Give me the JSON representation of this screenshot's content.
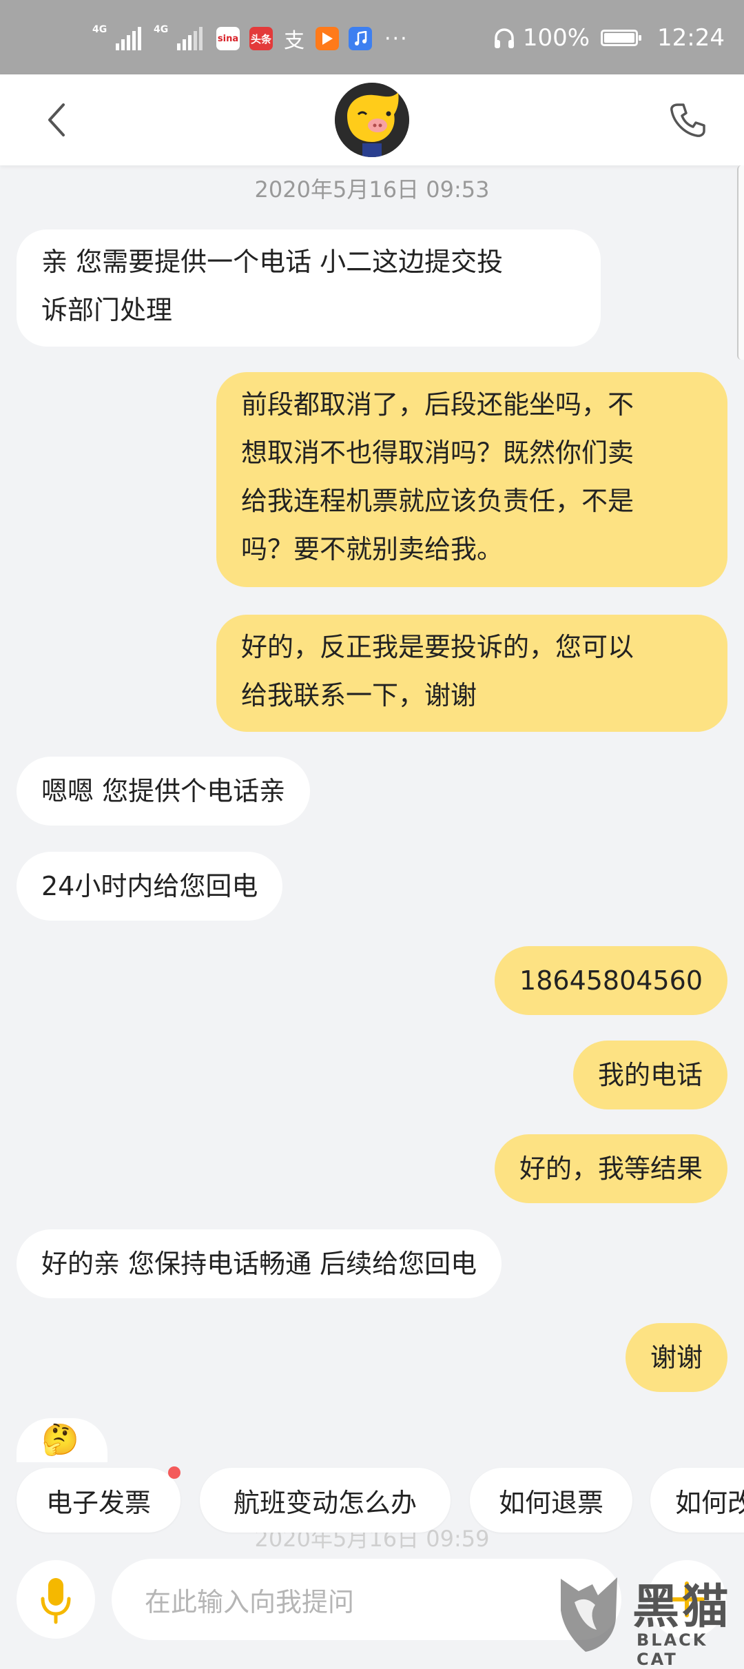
{
  "status_bar": {
    "network1": "4G",
    "network2": "4G",
    "apps": [
      "sina",
      "头条",
      "支",
      "play",
      "music"
    ],
    "more": "···",
    "battery_percent": "100%",
    "time": "12:24"
  },
  "header": {
    "back_icon": "chevron-left-icon",
    "avatar": "fliggy-mascot-avatar",
    "call_icon": "phone-icon"
  },
  "chat": {
    "timestamp": "2020年5月16日 09:53",
    "messages": [
      {
        "side": "in",
        "line1": "亲   您需要提供一个电话  小二这边提交投",
        "line2": "诉部门处理"
      },
      {
        "side": "out",
        "line1": "前段都取消了，后段还能坐吗，不",
        "line2": "想取消不也得取消吗？既然你们卖",
        "line3": "给我连程机票就应该负责任，不是",
        "line4": "吗？要不就别卖给我。"
      },
      {
        "side": "out",
        "line1": "好的，反正我是要投诉的，您可以",
        "line2": "给我联系一下，谢谢"
      },
      {
        "side": "in",
        "text": "嗯嗯   您提供个电话亲"
      },
      {
        "side": "in",
        "text": "24小时内给您回电"
      },
      {
        "side": "out",
        "text": "18645804560"
      },
      {
        "side": "out",
        "text": "我的电话"
      },
      {
        "side": "out",
        "text": "好的，我等结果"
      },
      {
        "side": "in",
        "text": "好的亲  您保持电话畅通 后续给您回电"
      },
      {
        "side": "out",
        "text": "谢谢"
      }
    ],
    "partial_emoji": "🤔",
    "faded_timestamp": "2020年5月16日 09:59"
  },
  "quick_replies": [
    "电子发票",
    "航班变动怎么办",
    "如何退票",
    "如何改"
  ],
  "input": {
    "placeholder": "在此输入向我提问",
    "mic_icon": "microphone-icon",
    "plus_icon": "plus-icon"
  },
  "watermark": {
    "title": "黑猫",
    "subtitle": "BLACK CAT"
  },
  "colors": {
    "outgoing_bubble": "#fde283",
    "incoming_bubble": "#ffffff",
    "background": "#f2f3f5",
    "status_bar": "#a6a6a6",
    "accent": "#f5b800"
  }
}
